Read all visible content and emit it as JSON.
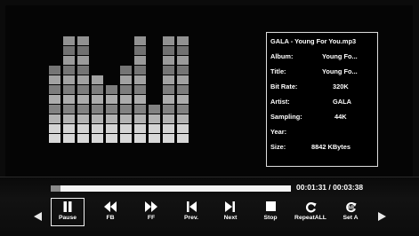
{
  "track": {
    "filename": "GALA - Young For You.mp3",
    "fields": [
      {
        "label": "Album:",
        "value": "Young Fo..."
      },
      {
        "label": "Title:",
        "value": "Young Fo..."
      },
      {
        "label": "Bit Rate:",
        "value": "320K"
      },
      {
        "label": "Artist:",
        "value": "GALA"
      },
      {
        "label": "Sampling:",
        "value": "44K"
      },
      {
        "label": "Year:",
        "value": ""
      },
      {
        "label": "Size:",
        "value": "8842 KBytes"
      }
    ]
  },
  "playback": {
    "time_display": "00:01:31 / 00:03:38",
    "progress_fraction": 0.04
  },
  "controls": [
    {
      "name": "pause-button",
      "icon": "pause-icon",
      "label": "Pause",
      "active": true
    },
    {
      "name": "fast-backward-button",
      "icon": "rewind-icon",
      "label": "FB",
      "active": false
    },
    {
      "name": "fast-forward-button",
      "icon": "fast-forward-icon",
      "label": "FF",
      "active": false
    },
    {
      "name": "previous-button",
      "icon": "skip-previous-icon",
      "label": "Prev.",
      "active": false
    },
    {
      "name": "next-button",
      "icon": "skip-next-icon",
      "label": "Next",
      "active": false
    },
    {
      "name": "stop-button",
      "icon": "stop-icon",
      "label": "Stop",
      "active": false
    },
    {
      "name": "repeat-all-button",
      "icon": "repeat-icon",
      "label": "RepeatALL",
      "active": false
    },
    {
      "name": "set-a-button",
      "icon": "ab-repeat-icon",
      "label": "Set A",
      "active": false
    }
  ],
  "visualizer": {
    "bar_levels": [
      8,
      11,
      11,
      7,
      6,
      8,
      11,
      4,
      11,
      11
    ]
  },
  "colors": {
    "background": "#050505",
    "accent_text": "#ffffff",
    "bar_light": "#d8d8d8",
    "bar_dark": "#8c8c8c"
  }
}
